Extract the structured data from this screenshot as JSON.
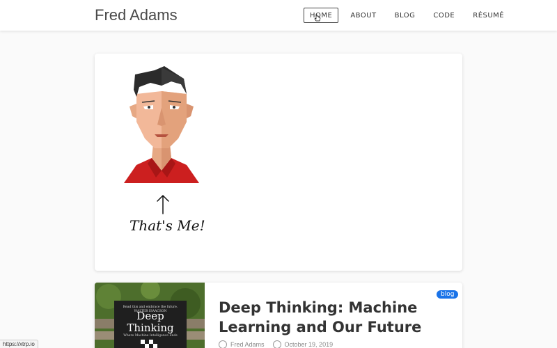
{
  "header": {
    "brand": "Fred Adams",
    "nav": [
      {
        "label": "HOME"
      },
      {
        "label": "ABOUT"
      },
      {
        "label": "BLOG"
      },
      {
        "label": "CODE"
      },
      {
        "label": "RÉSUMÉ"
      }
    ]
  },
  "hero": {
    "caption": "That's Me!"
  },
  "post": {
    "badge": "blog",
    "title": "Deep Thinking: Machine Learning and Our Future",
    "author": "Fred Adams",
    "date": "October 19, 2019",
    "book": {
      "blurb": "Read this and embrace the future.",
      "author": "WALTER ISAACSON",
      "title_line1": "Deep",
      "title_line2": "Thinking",
      "subtitle": "Where Machine Intelligence Ends"
    }
  },
  "status_bar": {
    "url": "https://xtrp.io"
  },
  "colors": {
    "accent": "#1a73e8",
    "shirt": "#cc1f1f",
    "hair": "#2b2b2b"
  }
}
